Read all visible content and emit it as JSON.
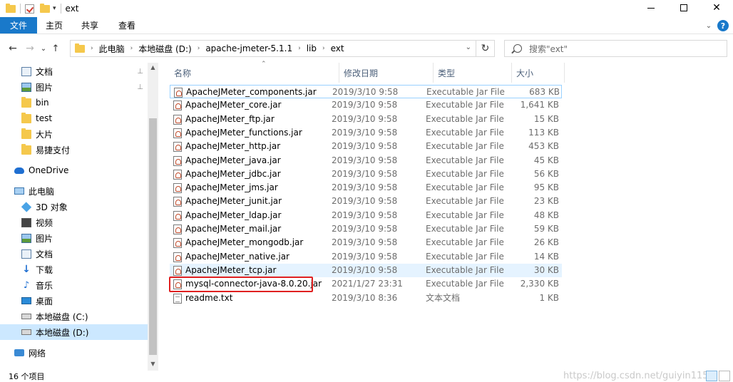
{
  "window": {
    "title": "ext",
    "quick_access_arrow": "▾",
    "minimize": "–",
    "maximize": "□",
    "close": "✕"
  },
  "ribbon": {
    "file": "文件",
    "tabs": [
      "主页",
      "共享",
      "查看"
    ],
    "expand": "⌄",
    "help": "?"
  },
  "nav": {
    "back": "←",
    "forward": "→",
    "recent": "⌄",
    "up": "↑",
    "refresh": "↻",
    "breadcrumbs": [
      "此电脑",
      "本地磁盘 (D:)",
      "apache-jmeter-5.1.1",
      "lib",
      "ext"
    ],
    "crumb_sep": "›",
    "dropdown": "⌄",
    "search_placeholder": "搜索\"ext\""
  },
  "sidebar": {
    "items": [
      {
        "label": "文档",
        "icon": "documents-icon",
        "pinned": true
      },
      {
        "label": "图片",
        "icon": "pictures-icon",
        "pinned": true
      },
      {
        "label": "bin",
        "icon": "folder-icon"
      },
      {
        "label": "test",
        "icon": "folder-icon"
      },
      {
        "label": "大片",
        "icon": "folder-icon"
      },
      {
        "label": "易捷支付",
        "icon": "folder-icon"
      },
      {
        "label": "OneDrive",
        "icon": "onedrive-icon"
      },
      {
        "label": "此电脑",
        "icon": "computer-icon"
      },
      {
        "label": "3D 对象",
        "icon": "3d-objects-icon"
      },
      {
        "label": "视频",
        "icon": "videos-icon"
      },
      {
        "label": "图片",
        "icon": "pictures-icon"
      },
      {
        "label": "文档",
        "icon": "documents-icon"
      },
      {
        "label": "下载",
        "icon": "downloads-icon"
      },
      {
        "label": "音乐",
        "icon": "music-icon"
      },
      {
        "label": "桌面",
        "icon": "desktop-icon"
      },
      {
        "label": "本地磁盘 (C:)",
        "icon": "drive-c-icon"
      },
      {
        "label": "本地磁盘 (D:)",
        "icon": "drive-d-icon",
        "selected": true
      },
      {
        "label": "网络",
        "icon": "network-icon"
      }
    ],
    "pin_glyph": "📌",
    "scroll_up": "▲",
    "scroll_down": "▼"
  },
  "columns": {
    "name": "名称",
    "date": "修改日期",
    "type": "类型",
    "size": "大小",
    "sort_caret": "⌃"
  },
  "files": [
    {
      "name": "ApacheJMeter_components.jar",
      "date": "2019/3/10 9:58",
      "type": "Executable Jar File",
      "size": "683 KB"
    },
    {
      "name": "ApacheJMeter_core.jar",
      "date": "2019/3/10 9:58",
      "type": "Executable Jar File",
      "size": "1,641 KB"
    },
    {
      "name": "ApacheJMeter_ftp.jar",
      "date": "2019/3/10 9:58",
      "type": "Executable Jar File",
      "size": "15 KB"
    },
    {
      "name": "ApacheJMeter_functions.jar",
      "date": "2019/3/10 9:58",
      "type": "Executable Jar File",
      "size": "113 KB"
    },
    {
      "name": "ApacheJMeter_http.jar",
      "date": "2019/3/10 9:58",
      "type": "Executable Jar File",
      "size": "453 KB"
    },
    {
      "name": "ApacheJMeter_java.jar",
      "date": "2019/3/10 9:58",
      "type": "Executable Jar File",
      "size": "45 KB"
    },
    {
      "name": "ApacheJMeter_jdbc.jar",
      "date": "2019/3/10 9:58",
      "type": "Executable Jar File",
      "size": "56 KB"
    },
    {
      "name": "ApacheJMeter_jms.jar",
      "date": "2019/3/10 9:58",
      "type": "Executable Jar File",
      "size": "95 KB"
    },
    {
      "name": "ApacheJMeter_junit.jar",
      "date": "2019/3/10 9:58",
      "type": "Executable Jar File",
      "size": "23 KB"
    },
    {
      "name": "ApacheJMeter_ldap.jar",
      "date": "2019/3/10 9:58",
      "type": "Executable Jar File",
      "size": "48 KB"
    },
    {
      "name": "ApacheJMeter_mail.jar",
      "date": "2019/3/10 9:58",
      "type": "Executable Jar File",
      "size": "59 KB"
    },
    {
      "name": "ApacheJMeter_mongodb.jar",
      "date": "2019/3/10 9:58",
      "type": "Executable Jar File",
      "size": "26 KB"
    },
    {
      "name": "ApacheJMeter_native.jar",
      "date": "2019/3/10 9:58",
      "type": "Executable Jar File",
      "size": "14 KB"
    },
    {
      "name": "ApacheJMeter_tcp.jar",
      "date": "2019/3/10 9:58",
      "type": "Executable Jar File",
      "size": "30 KB"
    },
    {
      "name": "mysql-connector-java-8.0.20.jar",
      "date": "2021/1/27 23:31",
      "type": "Executable Jar File",
      "size": "2,330 KB"
    },
    {
      "name": "readme.txt",
      "date": "2019/3/10 8:36",
      "type": "文本文档",
      "size": "1 KB"
    }
  ],
  "status": {
    "count": "16 个项目",
    "watermark": "https://blog.csdn.net/guiyin1150"
  },
  "colors": {
    "accent": "#1979ca",
    "selection": "#cce8ff",
    "hover": "#e5f3ff",
    "highlight": "#e02020"
  }
}
